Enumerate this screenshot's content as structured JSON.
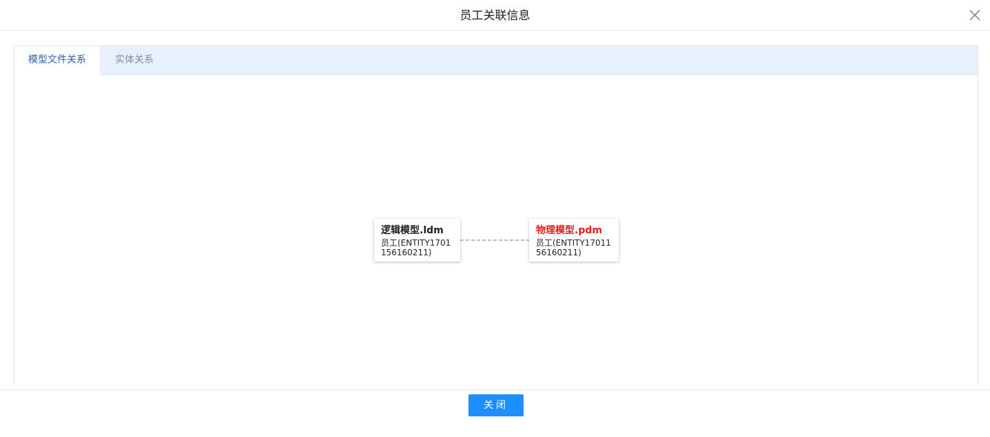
{
  "dialog": {
    "title": "员工关联信息",
    "close_icon": "close-icon"
  },
  "tabs": [
    {
      "label": "模型文件关系",
      "active": true
    },
    {
      "label": "实体关系",
      "active": false
    }
  ],
  "graph": {
    "nodes": [
      {
        "title": "逻辑模型.ldm",
        "subtitle": "员工(ENTITY1701156160211)",
        "title_color": "#000000"
      },
      {
        "title": "物理模型.pdm",
        "subtitle": "员工(ENTITY1701156160211)",
        "title_color": "#e02020"
      }
    ],
    "edge_style": "dashed"
  },
  "footer": {
    "close_label": "关闭"
  },
  "colors": {
    "accent": "#1e8fff",
    "active_tab_text": "#2e5ea8",
    "tab_bar_bg": "#e8f0fd"
  }
}
